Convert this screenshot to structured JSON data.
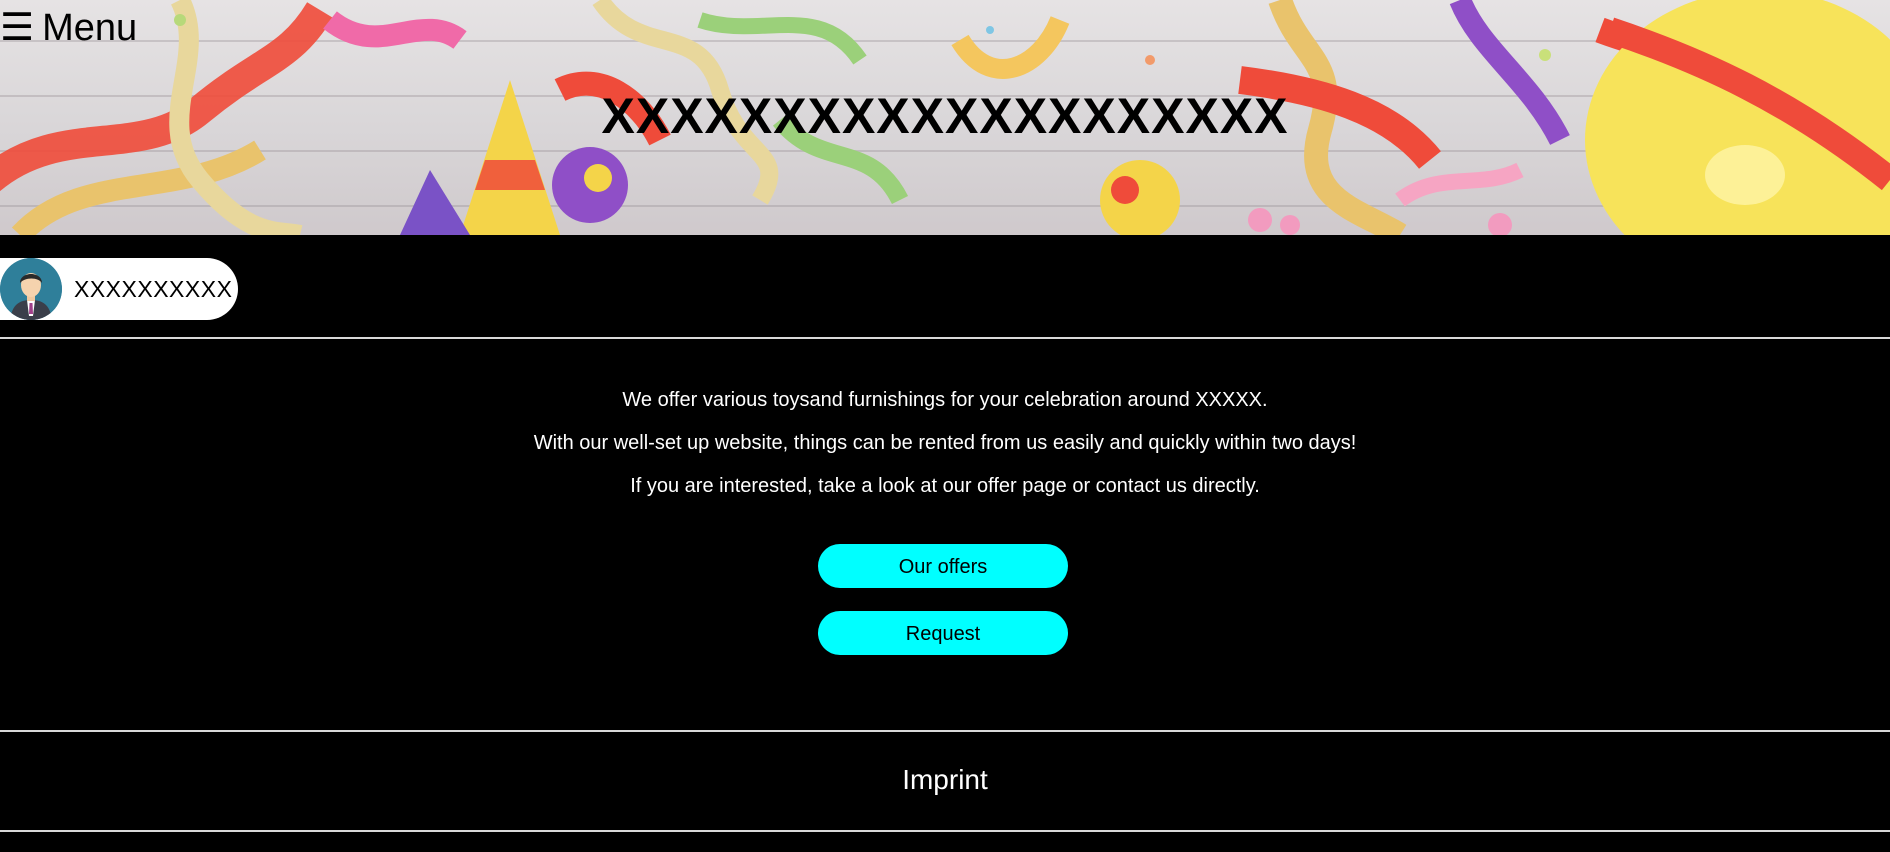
{
  "header": {
    "menu_label": "Menu",
    "menu_icon": "hamburger-icon",
    "site_title": "XXXXXXXXXXXXXXXXXXXX"
  },
  "profile": {
    "name": "XXXXXXXXXX",
    "avatar_icon": "user-avatar-icon"
  },
  "intro": {
    "line1": "We offer various toysand furnishings for your celebration around XXXXX.",
    "line2": "With our well-set up website, things can be rented from us easily and quickly within two days!",
    "line3": "If you are interested, take a look at our offer page or contact us directly."
  },
  "buttons": {
    "offers_label": "Our offers",
    "request_label": "Request"
  },
  "footer": {
    "imprint_label": "Imprint"
  },
  "colors": {
    "page_background": "#000000",
    "button_accent": "#00ffff",
    "text_light": "#ffffff"
  }
}
